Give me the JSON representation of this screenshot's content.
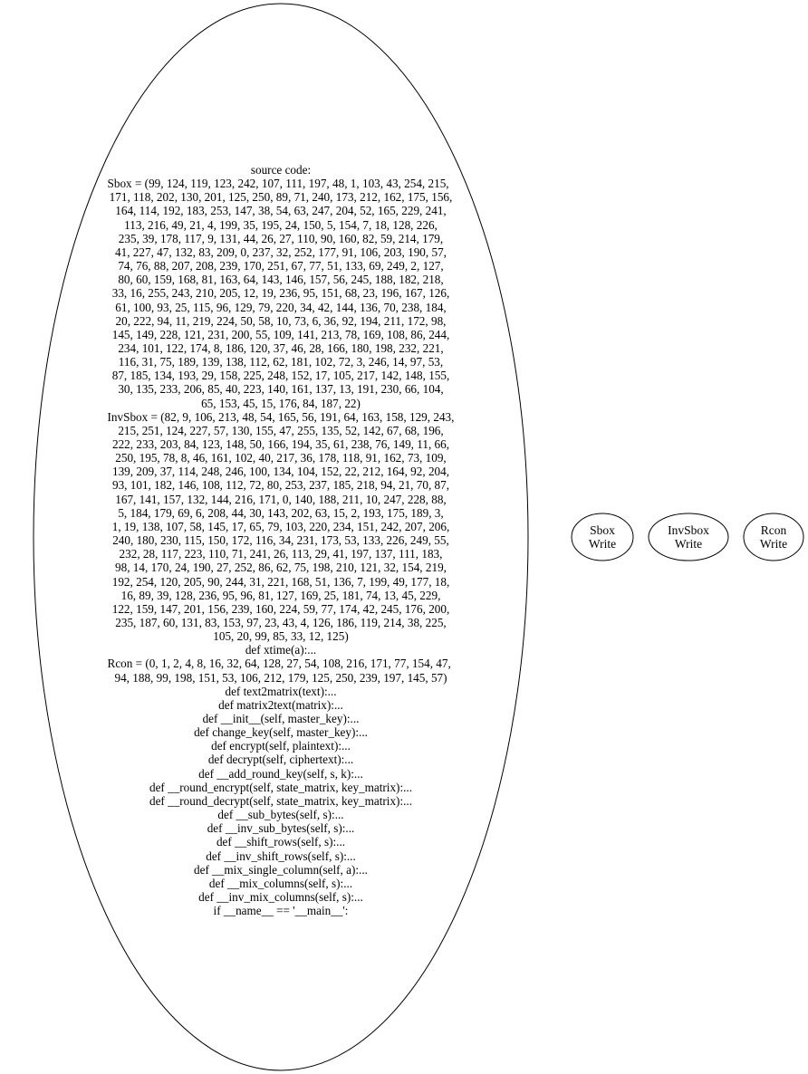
{
  "source_node": {
    "lines": [
      {
        "text": "source code:",
        "align": "center"
      },
      {
        "text": "Sbox = (99, 124, 119, 123, 242, 107, 111, 197, 48, 1, 103, 43, 254, 215,",
        "align": "left"
      },
      {
        "text": "171, 118, 202, 130, 201, 125, 250, 89, 71, 240, 173, 212, 162, 175, 156,",
        "align": "center"
      },
      {
        "text": "164, 114, 192, 183, 253, 147, 38, 54, 63, 247, 204, 52, 165, 229, 241,",
        "align": "center"
      },
      {
        "text": "113, 216, 49, 21, 4, 199, 35, 195, 24, 150, 5, 154, 7, 18, 128, 226,",
        "align": "center"
      },
      {
        "text": "235, 39, 178, 117, 9, 131, 44, 26, 27, 110, 90, 160, 82, 59, 214, 179,",
        "align": "center"
      },
      {
        "text": "41, 227, 47, 132, 83, 209, 0, 237, 32, 252, 177, 91, 106, 203, 190, 57,",
        "align": "center"
      },
      {
        "text": "74, 76, 88, 207, 208, 239, 170, 251, 67, 77, 51, 133, 69, 249, 2, 127,",
        "align": "center"
      },
      {
        "text": "80, 60, 159, 168, 81, 163, 64, 143, 146, 157, 56, 245, 188, 182, 218,",
        "align": "center"
      },
      {
        "text": "33, 16, 255, 243, 210, 205, 12, 19, 236, 95, 151, 68, 23, 196, 167, 126,",
        "align": "center"
      },
      {
        "text": "61, 100, 93, 25, 115, 96, 129, 79, 220, 34, 42, 144, 136, 70, 238, 184,",
        "align": "center"
      },
      {
        "text": "20, 222, 94, 11, 219, 224, 50, 58, 10, 73, 6, 36, 92, 194, 211, 172, 98,",
        "align": "center"
      },
      {
        "text": "145, 149, 228, 121, 231, 200, 55, 109, 141, 213, 78, 169, 108, 86, 244,",
        "align": "center"
      },
      {
        "text": "234, 101, 122, 174, 8, 186, 120, 37, 46, 28, 166, 180, 198, 232, 221,",
        "align": "center"
      },
      {
        "text": "116, 31, 75, 189, 139, 138, 112, 62, 181, 102, 72, 3, 246, 14, 97, 53,",
        "align": "center"
      },
      {
        "text": "87, 185, 134, 193, 29, 158, 225, 248, 152, 17, 105, 217, 142, 148, 155,",
        "align": "center"
      },
      {
        "text": "30, 135, 233, 206, 85, 40, 223, 140, 161, 137, 13, 191, 230, 66, 104,",
        "align": "center"
      },
      {
        "text": "65, 153, 45, 15, 176, 84, 187, 22)",
        "align": "center"
      },
      {
        "text": "InvSbox = (82, 9, 106, 213, 48, 54, 165, 56, 191, 64, 163, 158, 129, 243,",
        "align": "left"
      },
      {
        "text": "215, 251, 124, 227, 57, 130, 155, 47, 255, 135, 52, 142, 67, 68, 196,",
        "align": "center"
      },
      {
        "text": "222, 233, 203, 84, 123, 148, 50, 166, 194, 35, 61, 238, 76, 149, 11, 66,",
        "align": "center"
      },
      {
        "text": "250, 195, 78, 8, 46, 161, 102, 40, 217, 36, 178, 118, 91, 162, 73, 109,",
        "align": "center"
      },
      {
        "text": "139, 209, 37, 114, 248, 246, 100, 134, 104, 152, 22, 212, 164, 92, 204,",
        "align": "center"
      },
      {
        "text": "93, 101, 182, 146, 108, 112, 72, 80, 253, 237, 185, 218, 94, 21, 70, 87,",
        "align": "center"
      },
      {
        "text": "167, 141, 157, 132, 144, 216, 171, 0, 140, 188, 211, 10, 247, 228, 88,",
        "align": "center"
      },
      {
        "text": "5, 184, 179, 69, 6, 208, 44, 30, 143, 202, 63, 15, 2, 193, 175, 189, 3,",
        "align": "center"
      },
      {
        "text": "1, 19, 138, 107, 58, 145, 17, 65, 79, 103, 220, 234, 151, 242, 207, 206,",
        "align": "center"
      },
      {
        "text": "240, 180, 230, 115, 150, 172, 116, 34, 231, 173, 53, 133, 226, 249, 55,",
        "align": "center"
      },
      {
        "text": "232, 28, 117, 223, 110, 71, 241, 26, 113, 29, 41, 197, 137, 111, 183,",
        "align": "center"
      },
      {
        "text": "98, 14, 170, 24, 190, 27, 252, 86, 62, 75, 198, 210, 121, 32, 154, 219,",
        "align": "center"
      },
      {
        "text": "192, 254, 120, 205, 90, 244, 31, 221, 168, 51, 136, 7, 199, 49, 177, 18,",
        "align": "center"
      },
      {
        "text": "16, 89, 39, 128, 236, 95, 96, 81, 127, 169, 25, 181, 74, 13, 45, 229,",
        "align": "center"
      },
      {
        "text": "122, 159, 147, 201, 156, 239, 160, 224, 59, 77, 174, 42, 245, 176, 200,",
        "align": "center"
      },
      {
        "text": "235, 187, 60, 131, 83, 153, 97, 23, 43, 4, 126, 186, 119, 214, 38, 225,",
        "align": "center"
      },
      {
        "text": "105, 20, 99, 85, 33, 12, 125)",
        "align": "center"
      },
      {
        "text": "def xtime(a):...",
        "align": "center"
      },
      {
        "text": "Rcon = (0, 1, 2, 4, 8, 16, 32, 64, 128, 27, 54, 108, 216, 171, 77, 154, 47,",
        "align": "left"
      },
      {
        "text": "94, 188, 99, 198, 151, 53, 106, 212, 179, 125, 250, 239, 197, 145, 57)",
        "align": "center"
      },
      {
        "text": "def text2matrix(text):...",
        "align": "center"
      },
      {
        "text": "def matrix2text(matrix):...",
        "align": "center"
      },
      {
        "text": "def __init__(self, master_key):...",
        "align": "center"
      },
      {
        "text": "def change_key(self, master_key):...",
        "align": "center"
      },
      {
        "text": "def encrypt(self, plaintext):...",
        "align": "center"
      },
      {
        "text": "def decrypt(self, ciphertext):...",
        "align": "center"
      },
      {
        "text": "def __add_round_key(self, s, k):...",
        "align": "center"
      },
      {
        "text": "def __round_encrypt(self, state_matrix, key_matrix):...",
        "align": "center"
      },
      {
        "text": "def __round_decrypt(self, state_matrix, key_matrix):...",
        "align": "center"
      },
      {
        "text": "def __sub_bytes(self, s):...",
        "align": "center"
      },
      {
        "text": "def __inv_sub_bytes(self, s):...",
        "align": "center"
      },
      {
        "text": "def __shift_rows(self, s):...",
        "align": "center"
      },
      {
        "text": "def __inv_shift_rows(self, s):...",
        "align": "center"
      },
      {
        "text": "def __mix_single_column(self, a):...",
        "align": "center"
      },
      {
        "text": "def __mix_columns(self, s):...",
        "align": "center"
      },
      {
        "text": "def __inv_mix_columns(self, s):...",
        "align": "center"
      },
      {
        "text": "if __name__ == '__main__':",
        "align": "center"
      }
    ]
  },
  "side_nodes": [
    {
      "id": "sbox-write",
      "line1": "Sbox",
      "line2": "Write"
    },
    {
      "id": "invsbox-write",
      "line1": "InvSbox",
      "line2": "Write"
    },
    {
      "id": "rcon-write",
      "line1": "Rcon",
      "line2": "Write"
    }
  ],
  "colors": {
    "stroke": "#000000",
    "background": "#ffffff",
    "text": "#000000"
  }
}
